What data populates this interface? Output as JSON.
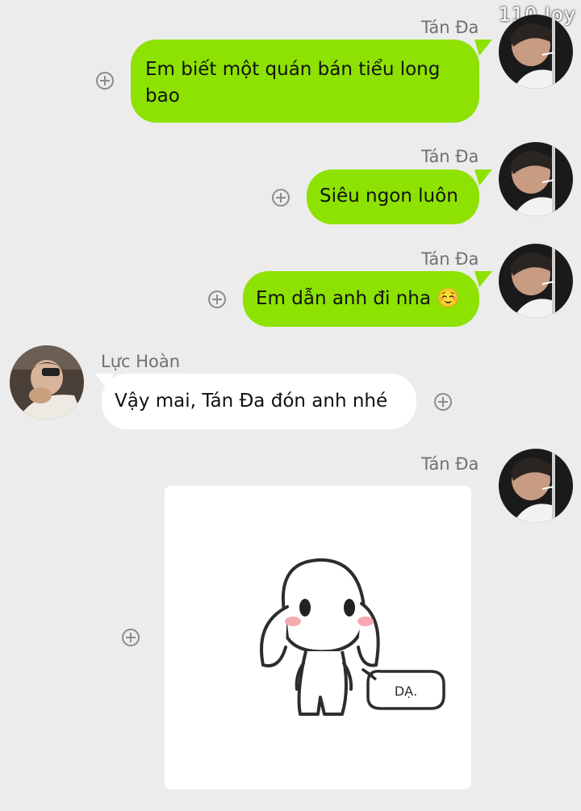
{
  "watermark": "110 Joy",
  "messages": [
    {
      "sender": "Tán Đa",
      "side": "right",
      "text": "Em biết một quán bán tiểu long bao"
    },
    {
      "sender": "Tán Đa",
      "side": "right",
      "text": "Siêu ngon luôn"
    },
    {
      "sender": "Tán Đa",
      "side": "right",
      "text": "Em dẫn anh đi nha ☺️"
    },
    {
      "sender": "Lực Hoàn",
      "side": "left",
      "text": "Vậy mai, Tán Đa đón anh nhé"
    },
    {
      "sender": "Tán Đa",
      "side": "right",
      "type": "sticker",
      "sticker_text": "DẠ."
    }
  ],
  "colors": {
    "background": "#ececec",
    "sent_bubble": "#8de202",
    "received_bubble": "#ffffff",
    "name_text": "#707070"
  },
  "icons": {
    "more": "plus-circle-icon"
  }
}
